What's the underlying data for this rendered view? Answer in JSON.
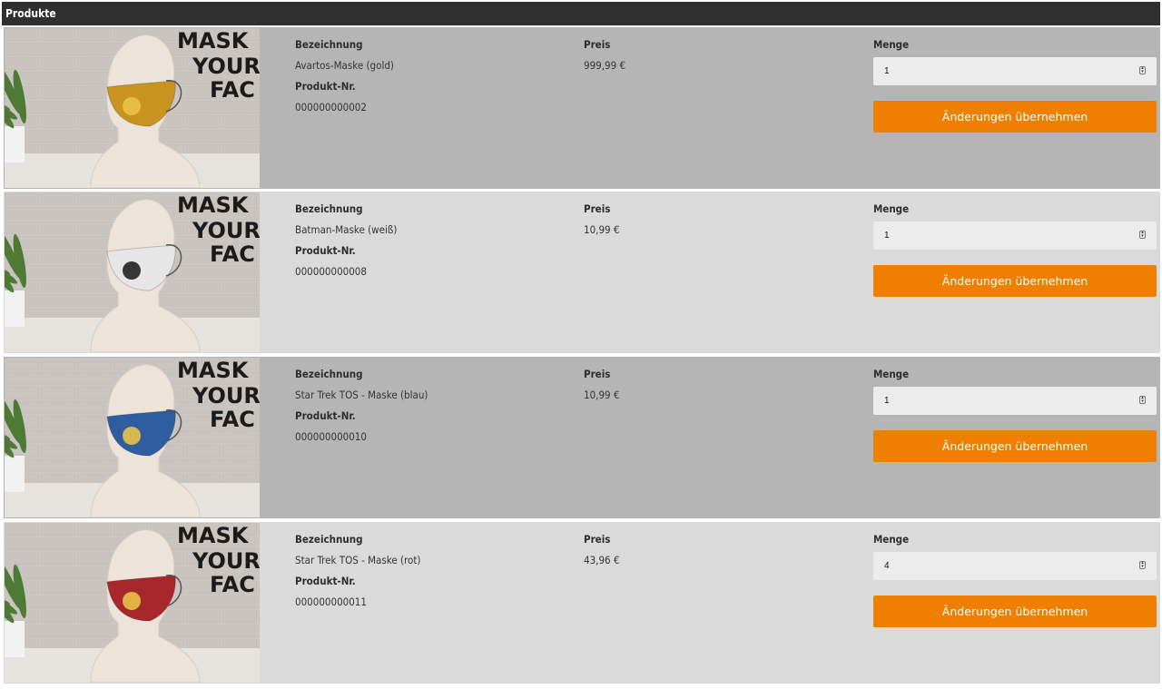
{
  "header": {
    "title": "Produkte"
  },
  "labels": {
    "name": "Bezeichnung",
    "price": "Preis",
    "product_no": "Produkt-Nr.",
    "quantity": "Menge",
    "apply_button": "Änderungen übernehmen"
  },
  "products": [
    {
      "name": "Avartos-Maske (gold)",
      "price": "999,99 €",
      "product_no": "000000000002",
      "quantity": "1",
      "mask_color": "#c8941f"
    },
    {
      "name": "Batman-Maske (weiß)",
      "price": "10,99 €",
      "product_no": "000000000008",
      "quantity": "1",
      "mask_color": "#e6e6e6"
    },
    {
      "name": "Star Trek TOS - Maske (blau)",
      "price": "10,99 €",
      "product_no": "000000000010",
      "quantity": "1",
      "mask_color": "#2e5da0"
    },
    {
      "name": "Star Trek TOS - Maske (rot)",
      "price": "43,96 €",
      "product_no": "000000000011",
      "quantity": "4",
      "mask_color": "#a8272b"
    }
  ],
  "image_text": [
    "MASK",
    "YOUR",
    "FAC"
  ],
  "colors": {
    "header": "#2f2f2f",
    "button": "#ee7f00"
  }
}
